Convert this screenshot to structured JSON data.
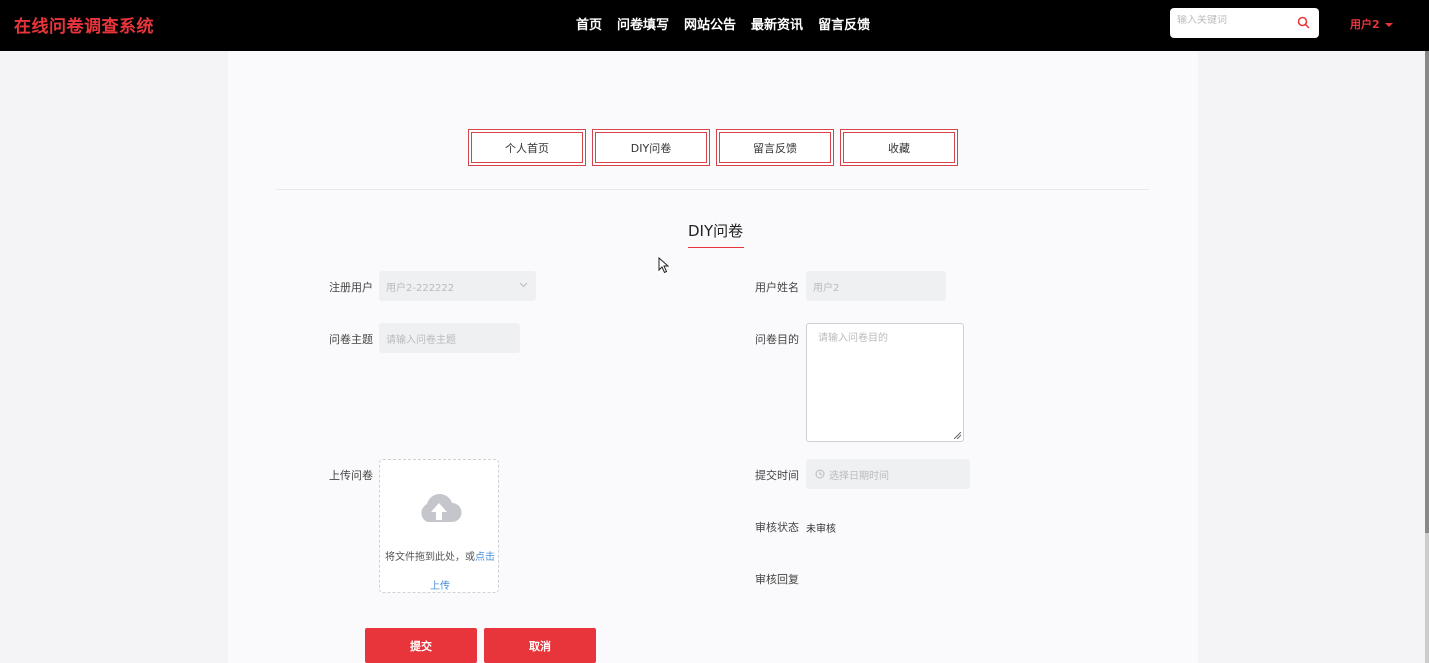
{
  "header": {
    "brand": "在线问卷调查系统",
    "nav": [
      "首页",
      "问卷填写",
      "网站公告",
      "最新资讯",
      "留言反馈"
    ],
    "search_placeholder": "输入关键词",
    "user_label": "用户2"
  },
  "tabs": [
    "个人首页",
    "DIY问卷",
    "留言反馈",
    "收藏"
  ],
  "form": {
    "title": "DIY问卷",
    "registered_user": {
      "label": "注册用户",
      "value": "用户2-222222"
    },
    "user_name": {
      "label": "用户姓名",
      "value": "用户2"
    },
    "subject": {
      "label": "问卷主题",
      "placeholder": "请输入问卷主题"
    },
    "purpose": {
      "label": "问卷目的",
      "placeholder": "请输入问卷目的"
    },
    "upload": {
      "label": "上传问卷",
      "hint": "将文件拖到此处，或",
      "hint_link": "点击",
      "hint_link2": "上传"
    },
    "submit_time": {
      "label": "提交时间",
      "placeholder": "选择日期时间"
    },
    "review_status": {
      "label": "审核状态",
      "value": "未审核"
    },
    "review_reply": {
      "label": "审核回复",
      "value": ""
    },
    "submit_button": "提交",
    "cancel_button": "取消"
  },
  "colors": {
    "accent": "#e8353b",
    "link": "#4a90d9",
    "topbar": "#000000"
  }
}
